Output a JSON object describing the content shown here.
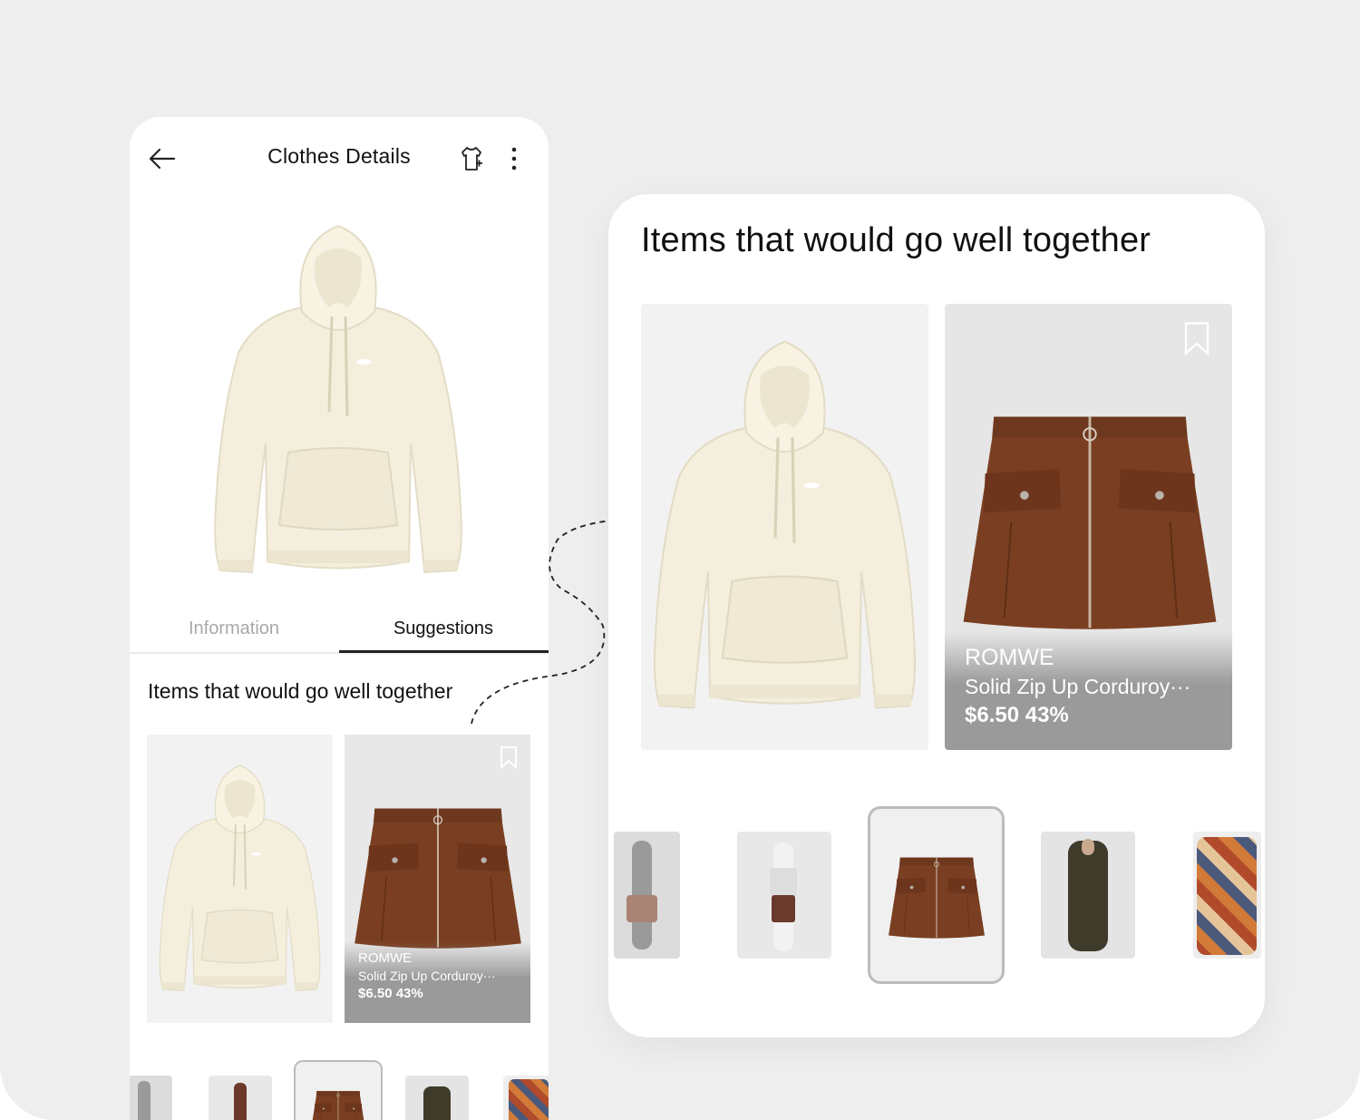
{
  "app": {
    "title": "Clothes Details",
    "icons": [
      "arrow-left-icon",
      "share-hanger-icon",
      "more-vertical-icon"
    ]
  },
  "tabs": [
    {
      "label": "Information",
      "active": false
    },
    {
      "label": "Suggestions",
      "active": true
    }
  ],
  "section": {
    "title": "Items that would go well together"
  },
  "product": {
    "brand": "ROMWE",
    "name": "Solid Zip Up Corduroy···",
    "price": "$6.50 43%"
  },
  "colors": {
    "background": "#eeeeee",
    "skirt": "#7a3f22",
    "hoodie": "#f4efdd",
    "active_tab_underline": "#222222",
    "inactive_tab": "#a8a8a8"
  },
  "thumbnails": [
    {
      "item": "gray-plaid-outfit",
      "selected": false
    },
    {
      "item": "floral-top-outfit",
      "selected": false
    },
    {
      "item": "corduroy-skirt",
      "selected": true
    },
    {
      "item": "olive-jacket-outfit",
      "selected": false
    },
    {
      "item": "patchwork-cardigan",
      "selected": false
    }
  ]
}
